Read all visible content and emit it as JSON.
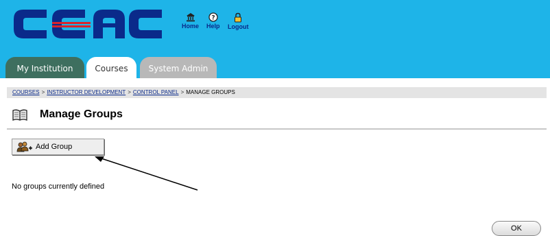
{
  "header": {
    "logo_text": "CCAC",
    "colors": {
      "background": "#1eb4e8",
      "logo": "#0a2a8a",
      "logo_stripe": "#d9242b"
    },
    "tools": [
      {
        "label": "Home",
        "icon": "home-icon"
      },
      {
        "label": "Help",
        "icon": "help-icon"
      },
      {
        "label": "Logout",
        "icon": "padlock-icon"
      }
    ]
  },
  "tabs": [
    {
      "label": "My Institution",
      "active": false
    },
    {
      "label": "Courses",
      "active": true
    },
    {
      "label": "System Admin",
      "active": false
    }
  ],
  "breadcrumb": {
    "items": [
      {
        "label": "COURSES",
        "link": true
      },
      {
        "label": "INSTRUCTOR DEVELOPMENT",
        "link": true
      },
      {
        "label": "CONTROL PANEL",
        "link": true
      },
      {
        "label": "MANAGE GROUPS",
        "link": false
      }
    ],
    "separator": ">"
  },
  "page": {
    "title": "Manage Groups",
    "title_icon": "book-icon",
    "add_button_label": "Add Group",
    "add_button_icon": "add-group-icon",
    "empty_message": "No groups currently defined",
    "ok_label": "OK"
  }
}
